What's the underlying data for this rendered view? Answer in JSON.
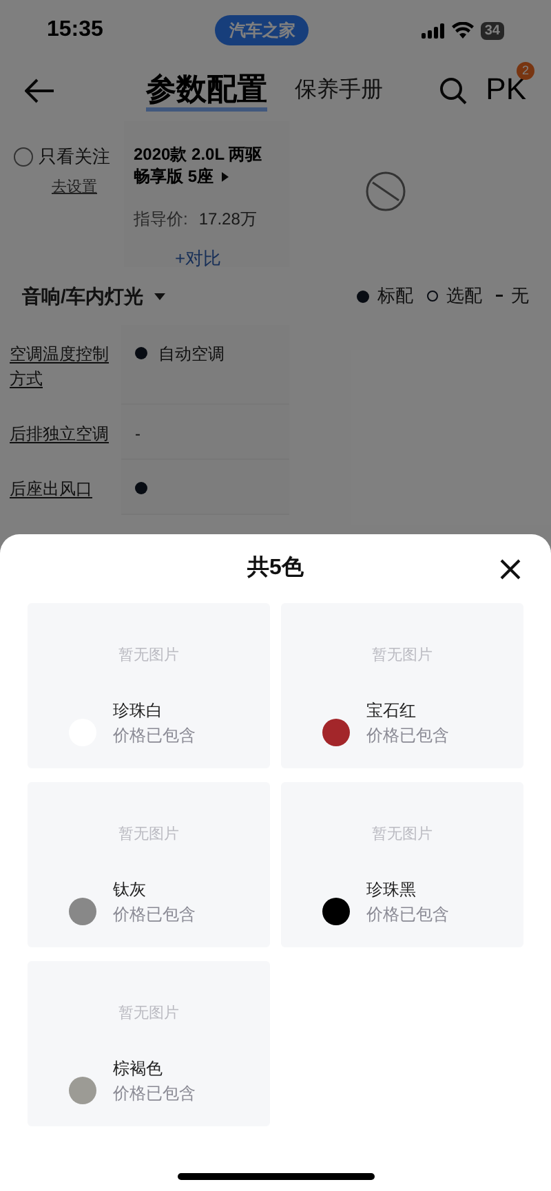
{
  "status_bar": {
    "time": "15:35",
    "app_badge": "汽车之家",
    "battery": "34"
  },
  "nav": {
    "tabs": [
      {
        "label": "参数配置",
        "selected": true
      },
      {
        "label": "保养手册",
        "selected": false
      }
    ],
    "pk_label": "PK",
    "pk_count": "2"
  },
  "filter": {
    "label": "只看关注",
    "checked": false,
    "link": "去设置"
  },
  "car": {
    "name": "2020款 2.0L 两驱畅享版 5座",
    "price_label": "指导价:",
    "price": "17.28万",
    "compare": "+对比"
  },
  "category": {
    "label": "音响/车内灯光"
  },
  "legend": [
    {
      "kind": "filled",
      "label": "标配"
    },
    {
      "kind": "hollow",
      "label": "选配"
    },
    {
      "kind": "dash",
      "label": "无"
    }
  ],
  "rows": [
    {
      "name": "空调温度控制方式",
      "kind": "filled",
      "value": "自动空调"
    },
    {
      "name": "后排独立空调",
      "kind": "dash",
      "value": "-"
    },
    {
      "name": "后座出风口",
      "kind": "filled"
    }
  ],
  "sheet": {
    "title": "共5色",
    "colors": [
      {
        "name": "珍珠白",
        "note": "价格已包含",
        "placeholder": "暂无图片",
        "color": "#ffffff"
      },
      {
        "name": "宝石红",
        "note": "价格已包含",
        "placeholder": "暂无图片",
        "color": "#a3262a"
      },
      {
        "name": "钛灰",
        "note": "价格已包含",
        "placeholder": "暂无图片",
        "color": "#888888"
      },
      {
        "name": "珍珠黑",
        "note": "价格已包含",
        "placeholder": "暂无图片",
        "color": "#000000"
      },
      {
        "name": "棕褐色",
        "note": "价格已包含",
        "placeholder": "暂无图片",
        "color": "#9c9b95"
      }
    ]
  }
}
